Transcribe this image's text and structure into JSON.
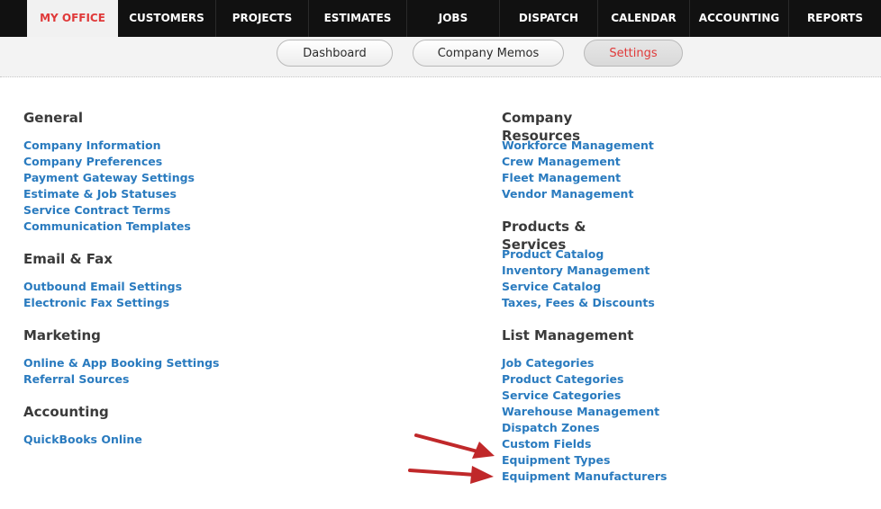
{
  "top_nav": {
    "tabs": [
      {
        "label": "MY OFFICE",
        "active": true
      },
      {
        "label": "CUSTOMERS",
        "active": false
      },
      {
        "label": "PROJECTS",
        "active": false
      },
      {
        "label": "ESTIMATES",
        "active": false
      },
      {
        "label": "JOBS",
        "active": false
      },
      {
        "label": "DISPATCH",
        "active": false
      },
      {
        "label": "CALENDAR",
        "active": false
      },
      {
        "label": "ACCOUNTING",
        "active": false
      },
      {
        "label": "REPORTS",
        "active": false
      }
    ]
  },
  "sub_nav": {
    "tabs": [
      {
        "label": "Dashboard",
        "active": false
      },
      {
        "label": "Company Memos",
        "active": false
      },
      {
        "label": "Settings",
        "active": true
      }
    ]
  },
  "left_column": {
    "sections": [
      {
        "title": "General",
        "links": [
          "Company Information",
          "Company Preferences",
          "Payment Gateway Settings",
          "Estimate & Job Statuses",
          "Service Contract Terms",
          "Communication Templates"
        ]
      },
      {
        "title": "Email & Fax",
        "links": [
          "Outbound Email Settings",
          "Electronic Fax Settings"
        ]
      },
      {
        "title": "Marketing",
        "links": [
          "Online & App Booking Settings",
          "Referral Sources"
        ]
      },
      {
        "title": "Accounting",
        "links": [
          "QuickBooks Online"
        ]
      }
    ]
  },
  "right_column": {
    "sections": [
      {
        "title": "Company Resources",
        "links": [
          "Workforce Management",
          "Crew Management",
          "Fleet Management",
          "Vendor Management"
        ]
      },
      {
        "title": "Products & Services",
        "links": [
          "Product Catalog",
          "Inventory Management",
          "Service Catalog",
          "Taxes, Fees & Discounts"
        ]
      },
      {
        "title": "List Management",
        "links": [
          "Job Categories",
          "Product Categories",
          "Service Categories",
          "Warehouse Management",
          "Dispatch Zones",
          "Custom Fields",
          "Equipment Types",
          "Equipment Manufacturers"
        ]
      }
    ]
  },
  "annotations": {
    "arrow_color": "#c0282a",
    "arrow_targets": [
      "Equipment Types",
      "Equipment Manufacturers"
    ]
  },
  "colors": {
    "nav_bg": "#111111",
    "active_accent": "#e03a3a",
    "link": "#2a7bbf",
    "heading": "#3a3a3a"
  }
}
